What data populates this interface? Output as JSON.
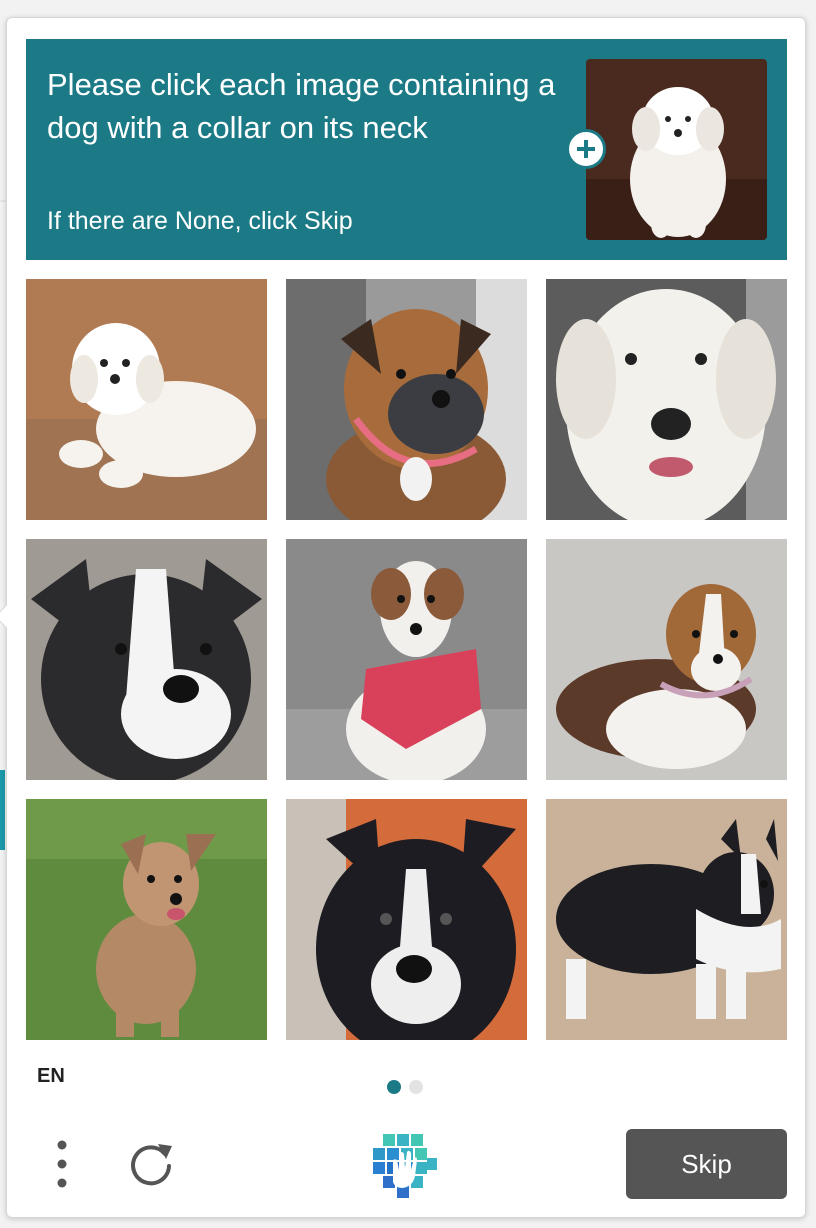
{
  "prompt": {
    "title": "Please click each image containing a dog with a collar on its neck",
    "subtitle": "If there are None, click Skip"
  },
  "colors": {
    "prompt_bg": "#1b7a86",
    "dot_active": "#1b7a86",
    "dot_inactive": "#e0e0e0",
    "skip_bg": "#555555"
  },
  "tiles": [
    {
      "name": "tile-white-fluffy-dog-lying"
    },
    {
      "name": "tile-boxer-pink-collar"
    },
    {
      "name": "tile-white-retriever"
    },
    {
      "name": "tile-black-white-bulldog"
    },
    {
      "name": "tile-dog-red-harness"
    },
    {
      "name": "tile-sheltie-collar"
    },
    {
      "name": "tile-tan-dog-grass"
    },
    {
      "name": "tile-black-white-collie-closeup"
    },
    {
      "name": "tile-black-white-collie-standing"
    }
  ],
  "footer": {
    "language": "EN",
    "skip_label": "Skip",
    "page_indicator": {
      "current": 1,
      "total": 2
    }
  },
  "icons": {
    "menu": "more-vertical-icon",
    "refresh": "refresh-icon",
    "logo": "hcaptcha-logo-icon",
    "example_add": "plus-circle-icon"
  }
}
